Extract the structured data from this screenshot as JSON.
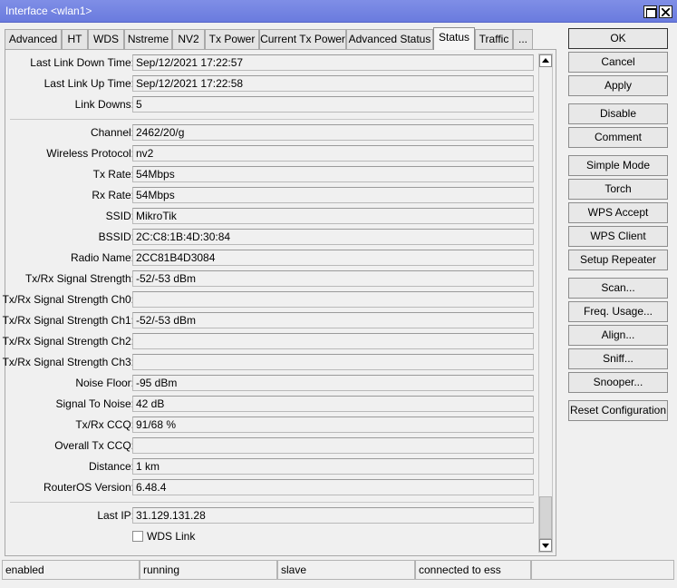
{
  "window": {
    "title": "Interface <wlan1>"
  },
  "tabs": [
    "Advanced",
    "HT",
    "WDS",
    "Nstreme",
    "NV2",
    "Tx Power",
    "Current Tx Power",
    "Advanced Status",
    "Status",
    "Traffic",
    "..."
  ],
  "active_tab": "Status",
  "fields": {
    "last_link_down_time": {
      "label": "Last Link Down Time:",
      "value": "Sep/12/2021 17:22:57"
    },
    "last_link_up_time": {
      "label": "Last Link Up Time:",
      "value": "Sep/12/2021 17:22:58"
    },
    "link_downs": {
      "label": "Link Downs:",
      "value": "5"
    },
    "channel": {
      "label": "Channel:",
      "value": "2462/20/g"
    },
    "wireless_protocol": {
      "label": "Wireless Protocol:",
      "value": "nv2"
    },
    "tx_rate": {
      "label": "Tx Rate:",
      "value": "54Mbps"
    },
    "rx_rate": {
      "label": "Rx Rate:",
      "value": "54Mbps"
    },
    "ssid": {
      "label": "SSID:",
      "value": "MikroTik"
    },
    "bssid": {
      "label": "BSSID:",
      "value": "2C:C8:1B:4D:30:84"
    },
    "radio_name": {
      "label": "Radio Name:",
      "value": "2CC81B4D3084"
    },
    "signal_strength": {
      "label": "Tx/Rx Signal Strength:",
      "value": "-52/-53 dBm"
    },
    "signal_strength_ch0": {
      "label": "Tx/Rx Signal Strength Ch0:",
      "value": ""
    },
    "signal_strength_ch1": {
      "label": "Tx/Rx Signal Strength Ch1:",
      "value": "-52/-53 dBm"
    },
    "signal_strength_ch2": {
      "label": "Tx/Rx Signal Strength Ch2:",
      "value": ""
    },
    "signal_strength_ch3": {
      "label": "Tx/Rx Signal Strength Ch3:",
      "value": ""
    },
    "noise_floor": {
      "label": "Noise Floor:",
      "value": "-95 dBm"
    },
    "signal_to_noise": {
      "label": "Signal To Noise:",
      "value": "42 dB"
    },
    "txrx_ccq": {
      "label": "Tx/Rx CCQ:",
      "value": "91/68 %"
    },
    "overall_tx_ccq": {
      "label": "Overall Tx CCQ:",
      "value": ""
    },
    "distance": {
      "label": "Distance:",
      "value": "1 km"
    },
    "routeros_version": {
      "label": "RouterOS Version:",
      "value": "6.48.4"
    },
    "last_ip": {
      "label": "Last IP:",
      "value": "31.129.131.28"
    }
  },
  "wds_link": {
    "label": "WDS Link",
    "checked": false
  },
  "buttons": {
    "ok": "OK",
    "cancel": "Cancel",
    "apply": "Apply",
    "disable": "Disable",
    "comment": "Comment",
    "simple_mode": "Simple Mode",
    "torch": "Torch",
    "wps_accept": "WPS Accept",
    "wps_client": "WPS Client",
    "setup_repeater": "Setup Repeater",
    "scan": "Scan...",
    "freq_usage": "Freq. Usage...",
    "align": "Align...",
    "sniff": "Sniff...",
    "snooper": "Snooper...",
    "reset_configuration": "Reset Configuration"
  },
  "statusbar": [
    "enabled",
    "running",
    "slave",
    "connected to ess",
    ""
  ],
  "icons": {
    "maximize": "maximize-icon",
    "close": "close-icon",
    "scroll_up": "arrow-up-icon",
    "scroll_down": "arrow-down-icon"
  },
  "colors": {
    "titlebar": "#6f80e0",
    "window_bg": "#f0f0f0"
  }
}
